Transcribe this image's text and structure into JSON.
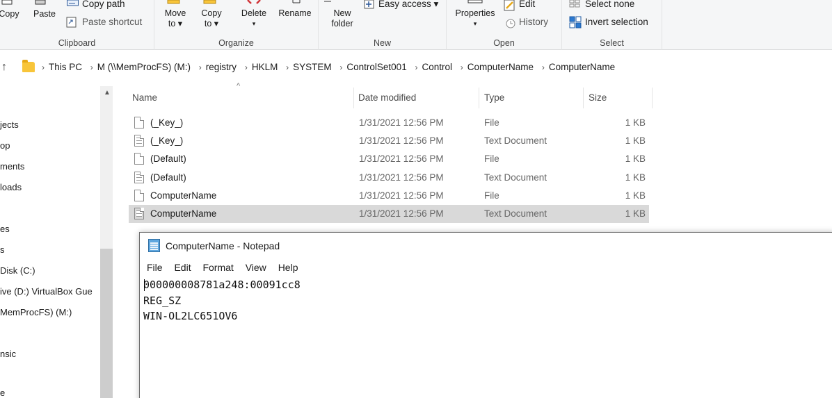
{
  "ribbon": {
    "clipboard": {
      "copy": "Copy",
      "paste": "Paste",
      "copy_path": "Copy path",
      "paste_shortcut": "Paste shortcut",
      "label": "Clipboard"
    },
    "organize": {
      "move_to": "Move",
      "move_to_2": "to ▾",
      "copy_to": "Copy",
      "copy_to_2": "to ▾",
      "delete": "Delete",
      "delete_arrow": "▾",
      "rename": "Rename",
      "label": "Organize"
    },
    "new": {
      "new_folder": "New",
      "new_folder_2": "folder",
      "easy_access": "Easy access ▾",
      "label": "New"
    },
    "open": {
      "properties": "Properties",
      "properties_arrow": "▾",
      "edit": "Edit",
      "history": "History",
      "label": "Open"
    },
    "select": {
      "select_none": "Select none",
      "invert_selection": "Invert selection",
      "label": "Select"
    }
  },
  "address": {
    "crumbs": [
      "This PC",
      "M (\\\\MemProcFS) (M:)",
      "registry",
      "HKLM",
      "SYSTEM",
      "ControlSet001",
      "Control",
      "ComputerName",
      "ComputerName"
    ]
  },
  "nav": {
    "items": [
      "jects",
      "op",
      "ments",
      "loads",
      "",
      "es",
      "s",
      "Disk (C:)",
      "ive (D:) VirtualBox Gue",
      "MemProcFS) (M:)",
      "",
      "nsic",
      "",
      "e"
    ]
  },
  "columns": {
    "name": "Name",
    "date": "Date modified",
    "type": "Type",
    "size": "Size"
  },
  "files": [
    {
      "name": "(_Key_)",
      "date": "1/31/2021 12:56 PM",
      "type": "File",
      "size": "1 KB"
    },
    {
      "name": "(_Key_)",
      "date": "1/31/2021 12:56 PM",
      "type": "Text Document",
      "size": "1 KB"
    },
    {
      "name": "(Default)",
      "date": "1/31/2021 12:56 PM",
      "type": "File",
      "size": "1 KB"
    },
    {
      "name": "(Default)",
      "date": "1/31/2021 12:56 PM",
      "type": "Text Document",
      "size": "1 KB"
    },
    {
      "name": "ComputerName",
      "date": "1/31/2021 12:56 PM",
      "type": "File",
      "size": "1 KB"
    },
    {
      "name": "ComputerName",
      "date": "1/31/2021 12:56 PM",
      "type": "Text Document",
      "size": "1 KB"
    }
  ],
  "notepad": {
    "title": "ComputerName - Notepad",
    "menu": [
      "File",
      "Edit",
      "Format",
      "View",
      "Help"
    ],
    "lines": [
      "000000008781a248:00091cc8",
      "REG_SZ",
      "WIN-OL2LC651OV6"
    ]
  },
  "colors": {
    "ribbon_bg": "#f5f6f7",
    "selected_row": "#d9d9d9",
    "folder_yellow": "#f8c53a"
  }
}
